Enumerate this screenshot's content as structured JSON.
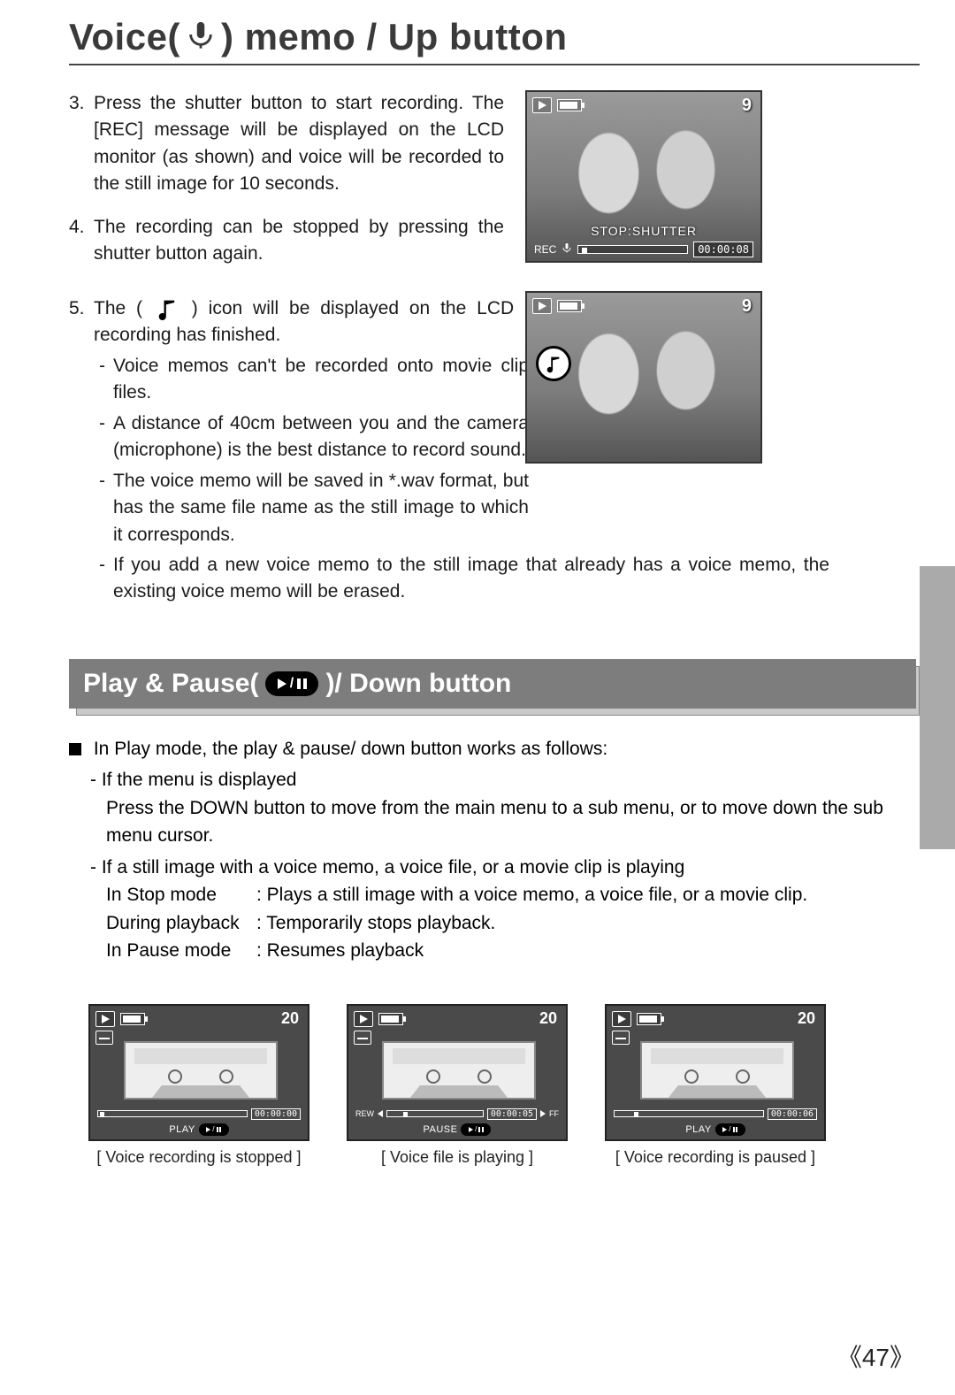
{
  "title": {
    "part1": "Voice(",
    "part2": ") memo / Up button"
  },
  "steps": {
    "s3": {
      "num": "3.",
      "text": "Press the shutter button to start recording. The [REC] message will be displayed on the LCD monitor (as shown) and voice will be recorded to the still image for 10 seconds."
    },
    "s4": {
      "num": "4.",
      "text": "The recording can be stopped by pressing the shutter button again."
    },
    "s5": {
      "num": "5.",
      "preA": "The (",
      "preB": ") icon will be displayed on the LCD monitor after voice memo recording has finished."
    }
  },
  "notes": {
    "n1": "Voice memos can't be recorded onto movie clip files.",
    "n2": "A distance of 40cm between you and the camera (microphone) is the best distance to record sound.",
    "n3": "The voice memo will be saved in *.wav format, but has the same file name as the still image to which it corresponds.",
    "n4": "If you add a new voice memo to the still image that already has a voice memo, the existing voice memo will be erased."
  },
  "lcdTop": {
    "count": "9",
    "stop": "STOP:SHUTTER",
    "rec": "REC",
    "time": "00:00:08"
  },
  "lcdTop2": {
    "count": "9"
  },
  "section2": {
    "header": {
      "a": "Play & Pause(",
      "b": ")/ Down button"
    },
    "intro": "In Play mode, the play & pause/ down button works as follows:",
    "b1_head": "If the menu is displayed",
    "b1_body": "Press the DOWN button to move from the main menu to a sub menu, or to move down the sub menu cursor.",
    "b2_head": "If a still image with a voice memo, a voice file, or a movie clip is playing",
    "modes": {
      "stop": {
        "label": "In Stop mode",
        "text": ": Plays a still image with a voice memo, a voice file, or a movie clip."
      },
      "play": {
        "label": "During playback",
        "text": ": Temporarily stops playback."
      },
      "pause": {
        "label": "In Pause mode",
        "text": ": Resumes playback"
      }
    }
  },
  "lcdRow": {
    "a": {
      "count": "20",
      "label": "PLAY",
      "time": "00:00:00",
      "caption": "[ Voice recording is stopped ]"
    },
    "b": {
      "count": "20",
      "label": "PAUSE",
      "rew": "REW",
      "ff": "FF",
      "time": "00:00:05",
      "caption": "[ Voice file is playing ]"
    },
    "c": {
      "count": "20",
      "label": "PLAY",
      "time": "00:00:06",
      "caption": "[ Voice recording is paused ]"
    }
  },
  "pageNumber": "《47》"
}
